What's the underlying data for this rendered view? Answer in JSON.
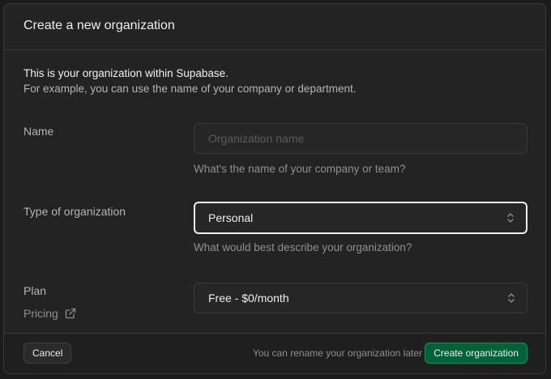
{
  "dialog": {
    "title": "Create a new organization"
  },
  "intro": {
    "title": "This is your organization within Supabase.",
    "description": "For example, you can use the name of your company or department."
  },
  "name_field": {
    "label": "Name",
    "placeholder": "Organization name",
    "value": "",
    "help": "What's the name of your company or team?"
  },
  "type_field": {
    "label": "Type of organization",
    "selected": "Personal",
    "help": "What would best describe your organization?"
  },
  "plan_field": {
    "label": "Plan",
    "selected": "Free - $0/month",
    "pricing_link": "Pricing",
    "pricing_icon": "external-link-icon"
  },
  "footer": {
    "cancel_label": "Cancel",
    "note": "You can rename your organization later",
    "create_label": "Create organization"
  },
  "colors": {
    "background": "#232323",
    "primary_button": "#006239",
    "primary_border": "#1c8a5c"
  }
}
